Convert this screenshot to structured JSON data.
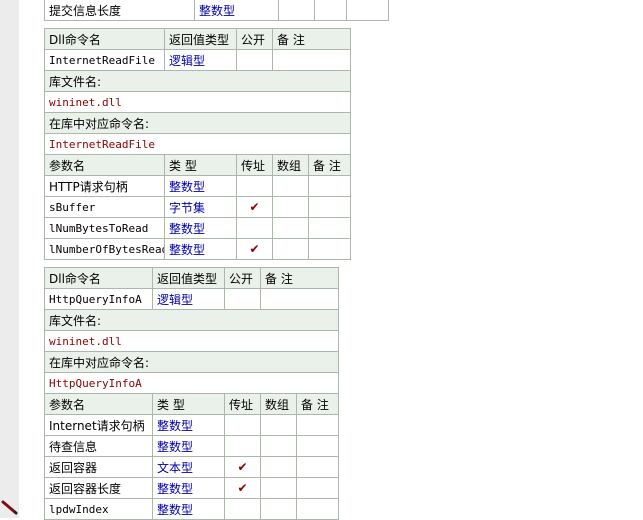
{
  "top_row": {
    "label": "提交信息长度",
    "type": "整数型"
  },
  "tables": [
    {
      "header": {
        "name_col": "Dll命令名",
        "ret_col": "返回值类型",
        "public_col": "公开",
        "note_col": "备 注"
      },
      "command_name": "InternetReadFile",
      "return_type": "逻辑型",
      "lib_label": "库文件名:",
      "lib_value": "wininet.dll",
      "alias_label": "在库中对应命令名:",
      "alias_value": "InternetReadFile",
      "param_header": {
        "name": "参数名",
        "type": "类 型",
        "byref": "传址",
        "array": "数组",
        "note": "备 注"
      },
      "params": [
        {
          "name": "HTTP请求句柄",
          "type": "整数型",
          "byref": ""
        },
        {
          "name": "sBuffer",
          "type": "字节集",
          "byref": "✔"
        },
        {
          "name": "lNumBytesToRead",
          "type": "整数型",
          "byref": ""
        },
        {
          "name": "lNumberOfBytesRead",
          "type": "整数型",
          "byref": "✔"
        }
      ]
    },
    {
      "header": {
        "name_col": "Dll命令名",
        "ret_col": "返回值类型",
        "public_col": "公开",
        "note_col": "备 注"
      },
      "command_name": "HttpQueryInfoA",
      "return_type": "逻辑型",
      "lib_label": "库文件名:",
      "lib_value": "wininet.dll",
      "alias_label": "在库中对应命令名:",
      "alias_value": "HttpQueryInfoA",
      "param_header": {
        "name": "参数名",
        "type": "类 型",
        "byref": "传址",
        "array": "数组",
        "note": "备 注"
      },
      "params": [
        {
          "name": "Internet请求句柄",
          "type": "整数型",
          "byref": ""
        },
        {
          "name": "待查信息",
          "type": "整数型",
          "byref": ""
        },
        {
          "name": "返回容器",
          "type": "文本型",
          "byref": "✔"
        },
        {
          "name": "返回容器长度",
          "type": "整数型",
          "byref": "✔"
        },
        {
          "name": "lpdwIndex",
          "type": "整数型",
          "byref": ""
        }
      ]
    }
  ],
  "icons": {
    "gutter": "edit-pencil-icon"
  }
}
